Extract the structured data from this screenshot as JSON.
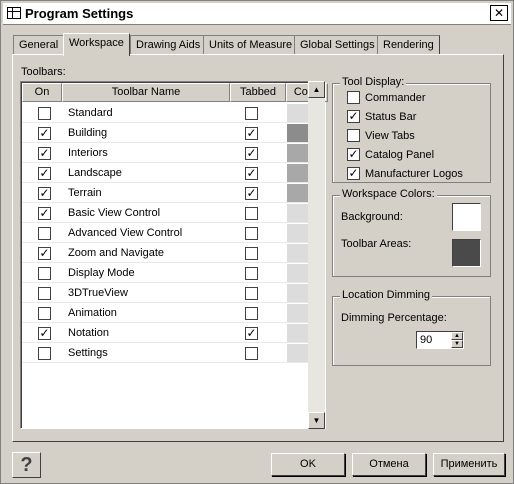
{
  "window": {
    "title": "Program Settings",
    "close_glyph": "✕"
  },
  "tabs": [
    {
      "label": "General"
    },
    {
      "label": "Workspace"
    },
    {
      "label": "Drawing Aids"
    },
    {
      "label": "Units of Measure"
    },
    {
      "label": "Global Settings"
    },
    {
      "label": "Rendering"
    }
  ],
  "toolbars": {
    "label": "Toolbars:",
    "columns": {
      "on": "On",
      "name": "Toolbar Name",
      "tabbed": "Tabbed",
      "color": "Color"
    },
    "rows": [
      {
        "on": false,
        "name": "Standard",
        "tabbed": false,
        "color": "#dcdcdc"
      },
      {
        "on": true,
        "name": "Building",
        "tabbed": true,
        "color": "#8c8c8c"
      },
      {
        "on": true,
        "name": "Interiors",
        "tabbed": true,
        "color": "#a8a8a8"
      },
      {
        "on": true,
        "name": "Landscape",
        "tabbed": true,
        "color": "#a8a8a8"
      },
      {
        "on": true,
        "name": "Terrain",
        "tabbed": true,
        "color": "#a8a8a8"
      },
      {
        "on": true,
        "name": "Basic View Control",
        "tabbed": false,
        "color": "#dcdcdc"
      },
      {
        "on": false,
        "name": "Advanced View Control",
        "tabbed": false,
        "color": "#dcdcdc"
      },
      {
        "on": true,
        "name": "Zoom and Navigate",
        "tabbed": false,
        "color": "#dcdcdc"
      },
      {
        "on": false,
        "name": "Display Mode",
        "tabbed": false,
        "color": "#dcdcdc"
      },
      {
        "on": false,
        "name": "3DTrueView",
        "tabbed": false,
        "color": "#dcdcdc"
      },
      {
        "on": false,
        "name": "Animation",
        "tabbed": false,
        "color": "#dcdcdc"
      },
      {
        "on": true,
        "name": "Notation",
        "tabbed": true,
        "color": "#dcdcdc"
      },
      {
        "on": false,
        "name": "Settings",
        "tabbed": false,
        "color": "#dcdcdc"
      }
    ]
  },
  "tool_display": {
    "title": "Tool Display:",
    "options": [
      {
        "label": "Commander",
        "checked": false
      },
      {
        "label": "Status Bar",
        "checked": true
      },
      {
        "label": "View Tabs",
        "checked": false
      },
      {
        "label": "Catalog Panel",
        "checked": true
      },
      {
        "label": "Manufacturer Logos",
        "checked": true
      }
    ]
  },
  "workspace_colors": {
    "title": "Workspace Colors:",
    "background_label": "Background:",
    "background_color": "#ffffff",
    "toolbar_areas_label": "Toolbar Areas:",
    "toolbar_areas_color": "#4a4a4a"
  },
  "location_dimming": {
    "title": "Location Dimming",
    "percentage_label": "Dimming Percentage:",
    "percentage_value": "90"
  },
  "buttons": {
    "help": "?",
    "ok": "OK",
    "cancel": "Отмена",
    "apply": "Применить"
  },
  "check_glyph": "✓"
}
